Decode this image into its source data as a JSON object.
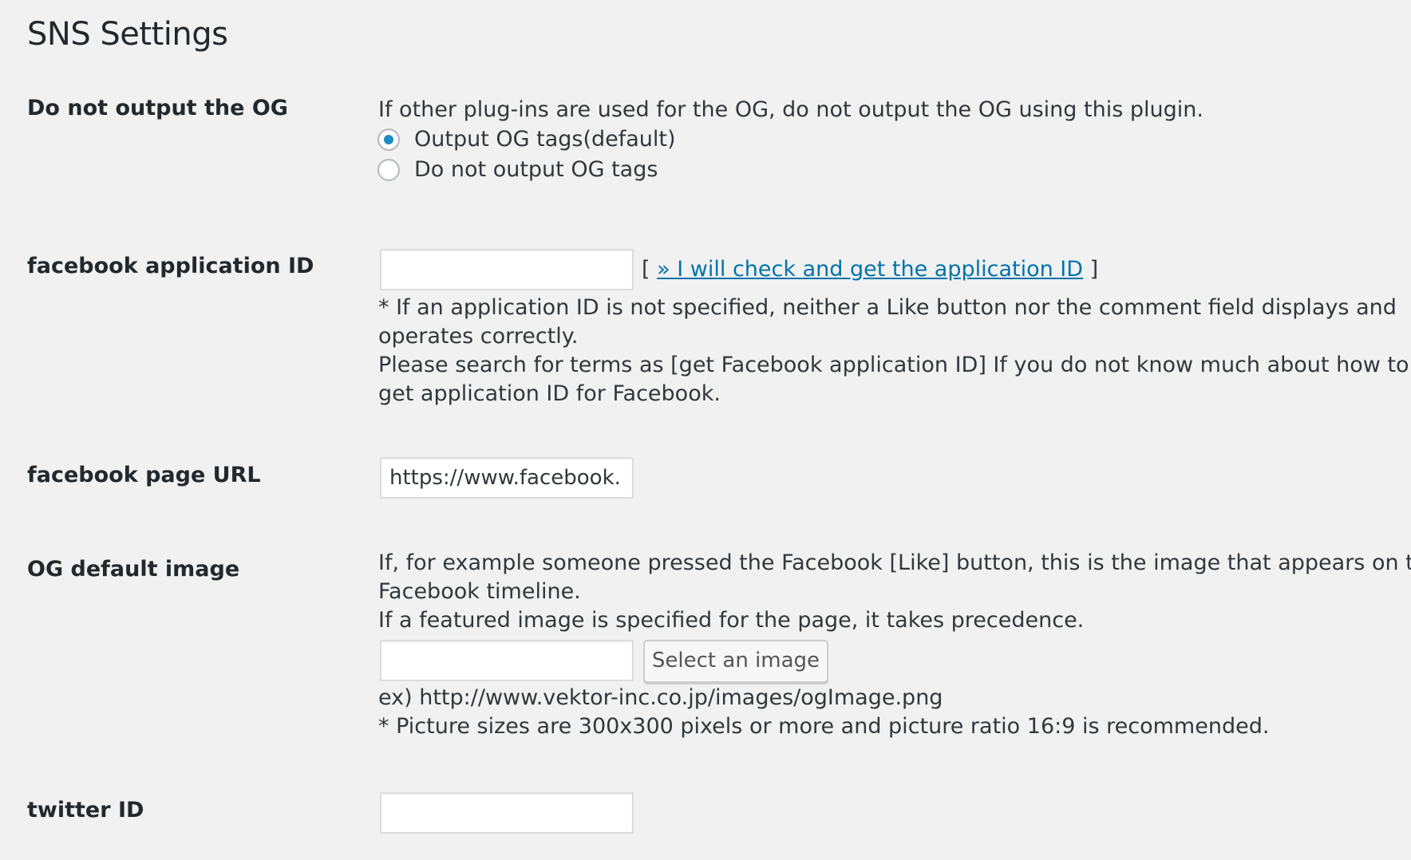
{
  "page": {
    "title": "SNS Settings"
  },
  "og_output": {
    "label": "Do not output the OG",
    "description": "If other plug-ins are used for the OG, do not output the OG using this plugin.",
    "options": [
      {
        "label": "Output OG tags(default)",
        "checked": true
      },
      {
        "label": "Do not output OG tags",
        "checked": false
      }
    ]
  },
  "fb_app_id": {
    "label": "facebook application ID",
    "value": "",
    "bracket_open": "[",
    "link_text": "» I will check and get the application ID",
    "bracket_close": "]",
    "note_lines": [
      "* If an application ID is not specified, neither a Like button nor the comment field displays and",
      "operates correctly.",
      "Please search for terms as [get Facebook application ID] If you do not know much about how to",
      "get application ID for Facebook."
    ]
  },
  "fb_page_url": {
    "label": "facebook page URL",
    "value": "https://www.facebook."
  },
  "og_image": {
    "label": "OG default image",
    "desc_lines": [
      "If, for example someone pressed the Facebook [Like] button, this is the image that appears on the",
      "Facebook timeline.",
      "If a featured image is specified for the page, it takes precedence."
    ],
    "value": "",
    "button_label": "Select an image",
    "example": "ex) http://www.vektor-inc.co.jp/images/ogImage.png",
    "size_note": "* Picture sizes are 300x300 pixels or more and picture ratio 16:9 is recommended."
  },
  "twitter_id": {
    "label": "twitter ID",
    "value": ""
  },
  "colors": {
    "background": "#f1f1f1",
    "link": "#0073aa",
    "radio_checked": "#1e8cbe"
  }
}
